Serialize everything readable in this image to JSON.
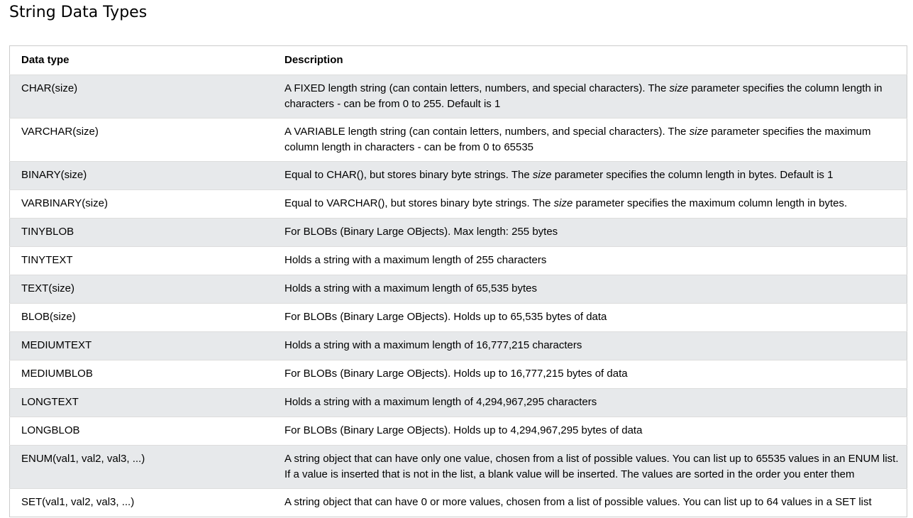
{
  "page": {
    "title": "String Data Types"
  },
  "table": {
    "headers": {
      "type": "Data type",
      "description": "Description"
    },
    "rows": [
      {
        "type": "CHAR(size)",
        "desc_before": "A FIXED length string (can contain letters, numbers, and special characters). The ",
        "desc_emph": "size",
        "desc_after": " parameter specifies the column length in characters - can be from 0 to 255. Default is 1"
      },
      {
        "type": "VARCHAR(size)",
        "desc_before": "A VARIABLE length string (can contain letters, numbers, and special characters). The ",
        "desc_emph": "size",
        "desc_after": " parameter specifies the maximum column length in characters - can be from 0 to 65535"
      },
      {
        "type": "BINARY(size)",
        "desc_before": "Equal to CHAR(), but stores binary byte strings. The ",
        "desc_emph": "size",
        "desc_after": " parameter specifies the column length in bytes. Default is 1"
      },
      {
        "type": "VARBINARY(size)",
        "desc_before": "Equal to VARCHAR(), but stores binary byte strings. The ",
        "desc_emph": "size",
        "desc_after": " parameter specifies the maximum column length in bytes."
      },
      {
        "type": "TINYBLOB",
        "desc_before": "For BLOBs (Binary Large OBjects). Max length: 255 bytes",
        "desc_emph": "",
        "desc_after": ""
      },
      {
        "type": "TINYTEXT",
        "desc_before": "Holds a string with a maximum length of 255 characters",
        "desc_emph": "",
        "desc_after": ""
      },
      {
        "type": "TEXT(size)",
        "desc_before": "Holds a string with a maximum length of 65,535 bytes",
        "desc_emph": "",
        "desc_after": ""
      },
      {
        "type": "BLOB(size)",
        "desc_before": "For BLOBs (Binary Large OBjects). Holds up to 65,535 bytes of data",
        "desc_emph": "",
        "desc_after": ""
      },
      {
        "type": "MEDIUMTEXT",
        "desc_before": "Holds a string with a maximum length of 16,777,215 characters",
        "desc_emph": "",
        "desc_after": ""
      },
      {
        "type": "MEDIUMBLOB",
        "desc_before": "For BLOBs (Binary Large OBjects). Holds up to 16,777,215 bytes of data",
        "desc_emph": "",
        "desc_after": ""
      },
      {
        "type": "LONGTEXT",
        "desc_before": "Holds a string with a maximum length of 4,294,967,295 characters",
        "desc_emph": "",
        "desc_after": ""
      },
      {
        "type": "LONGBLOB",
        "desc_before": "For BLOBs (Binary Large OBjects). Holds up to 4,294,967,295 bytes of data",
        "desc_emph": "",
        "desc_after": ""
      },
      {
        "type": "ENUM(val1, val2, val3, ...)",
        "desc_before": "A string object that can have only one value, chosen from a list of possible values. You can list up to 65535 values in an ENUM list. If a value is inserted that is not in the list, a blank value will be inserted. The values are sorted in the order you enter them",
        "desc_emph": "",
        "desc_after": ""
      },
      {
        "type": "SET(val1, val2, val3, ...)",
        "desc_before": "A string object that can have 0 or more values, chosen from a list of possible values. You can list up to 64 values in a SET list",
        "desc_emph": "",
        "desc_after": ""
      }
    ]
  },
  "colors": {
    "stripe": "#e7e9eb",
    "border": "#cccccc",
    "text": "#000000"
  }
}
